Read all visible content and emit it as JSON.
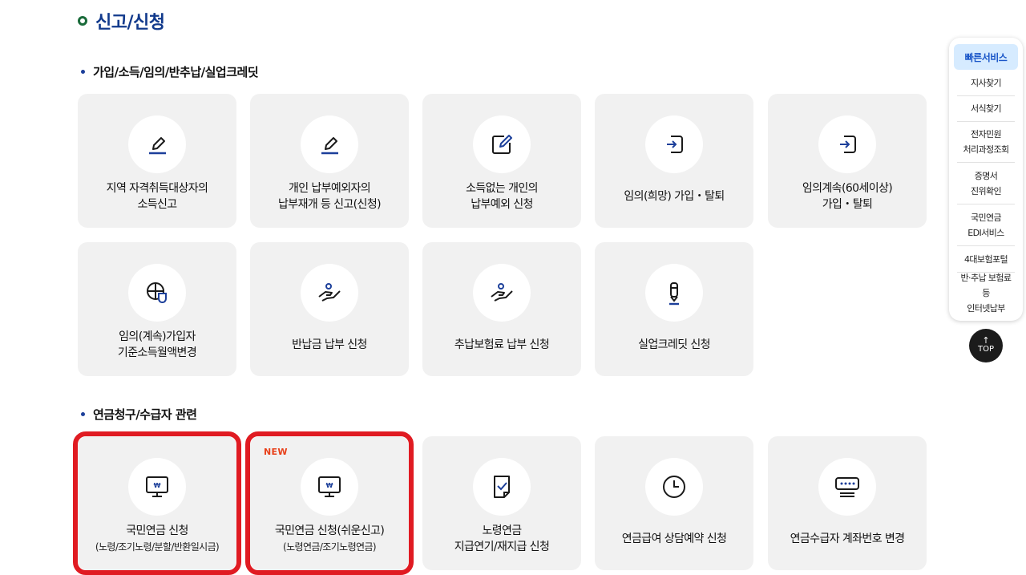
{
  "page": {
    "title": "신고/신청"
  },
  "sections": [
    {
      "heading": "가입/소득/임의/반추납/실업크레딧",
      "cards": [
        {
          "line1": "지역 자격취득대상자의",
          "line2": "소득신고",
          "icon": "pencil-icon"
        },
        {
          "line1": "개인 납부예외자의",
          "line2": "납부재개 등 신고(신청)",
          "icon": "pencil-icon"
        },
        {
          "line1": "소득없는 개인의",
          "line2": "납부예외 신청",
          "icon": "edit-box-icon"
        },
        {
          "line1": "임의(희망) 가입・탈퇴",
          "line2": "",
          "icon": "login-icon"
        },
        {
          "line1": "임의계속(60세이상)",
          "line2": "가입・탈퇴",
          "icon": "login-icon"
        },
        {
          "line1": "임의(계속)가입자",
          "line2": "기준소득월액변경",
          "icon": "globe-shield-icon"
        },
        {
          "line1": "반납금 납부 신청",
          "line2": "",
          "icon": "hand-payment-icon"
        },
        {
          "line1": "추납보험료 납부 신청",
          "line2": "",
          "icon": "hand-payment-icon"
        },
        {
          "line1": "실업크레딧 신청",
          "line2": "",
          "icon": "pen-icon"
        }
      ]
    },
    {
      "heading": "연금청구/수급자 관련",
      "cards": [
        {
          "line1": "국민연금 신청",
          "sub": "(노령/조기노령/분할/반환일시금)",
          "icon": "monitor-won-icon",
          "badge": ""
        },
        {
          "line1": "국민연금 신청(쉬운신고)",
          "sub": "(노령연금/조기노령연금)",
          "icon": "monitor-won-icon",
          "badge": "NEW"
        },
        {
          "line1": "노령연금",
          "line2": "지급연기/재지급 신청",
          "icon": "document-check-icon"
        },
        {
          "line1": "연금급여 상담예약 신청",
          "line2": "",
          "icon": "clock-icon"
        },
        {
          "line1": "연금수급자 계좌번호 변경",
          "line2": "",
          "icon": "password-device-icon"
        }
      ]
    }
  ],
  "quick_menu": {
    "title": "빠른서비스",
    "items": [
      {
        "line1": "지사찾기",
        "line2": ""
      },
      {
        "line1": "서식찾기",
        "line2": ""
      },
      {
        "line1": "전자민원",
        "line2": "처리과정조회"
      },
      {
        "line1": "증명서",
        "line2": "진위확인"
      },
      {
        "line1": "국민연금",
        "line2": "EDI서비스"
      },
      {
        "line1": "4대보험포털",
        "line2": ""
      },
      {
        "line1": "반·추납 보험료등",
        "line2": "인터넷납부"
      }
    ]
  },
  "top_button": {
    "arrow": "↑",
    "label": "TOP"
  },
  "colors": {
    "title": "#123a8c",
    "accent": "#1c3f9a",
    "highlight": "#e01b22",
    "badge": "#e8401a",
    "card_bg": "#f1f1f1"
  }
}
